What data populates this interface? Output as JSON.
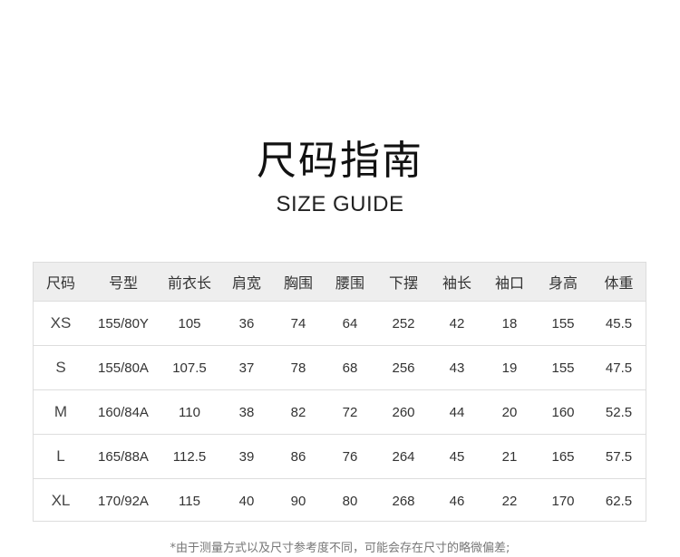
{
  "title_cn": "尺码指南",
  "title_en": "SIZE GUIDE",
  "table": {
    "headers": [
      "尺码",
      "号型",
      "前衣长",
      "肩宽",
      "胸围",
      "腰围",
      "下摆",
      "袖长",
      "袖口",
      "身高",
      "体重"
    ],
    "rows": [
      [
        "XS",
        "155/80Y",
        "105",
        "36",
        "74",
        "64",
        "252",
        "42",
        "18",
        "155",
        "45.5"
      ],
      [
        "S",
        "155/80A",
        "107.5",
        "37",
        "78",
        "68",
        "256",
        "43",
        "19",
        "155",
        "47.5"
      ],
      [
        "M",
        "160/84A",
        "110",
        "38",
        "82",
        "72",
        "260",
        "44",
        "20",
        "160",
        "52.5"
      ],
      [
        "L",
        "165/88A",
        "112.5",
        "39",
        "86",
        "76",
        "264",
        "45",
        "21",
        "165",
        "57.5"
      ],
      [
        "XL",
        "170/92A",
        "115",
        "40",
        "90",
        "80",
        "268",
        "46",
        "22",
        "170",
        "62.5"
      ]
    ]
  },
  "footnote": "*由于测量方式以及尺寸参考度不同，可能会存在尺寸的略微偏差;"
}
